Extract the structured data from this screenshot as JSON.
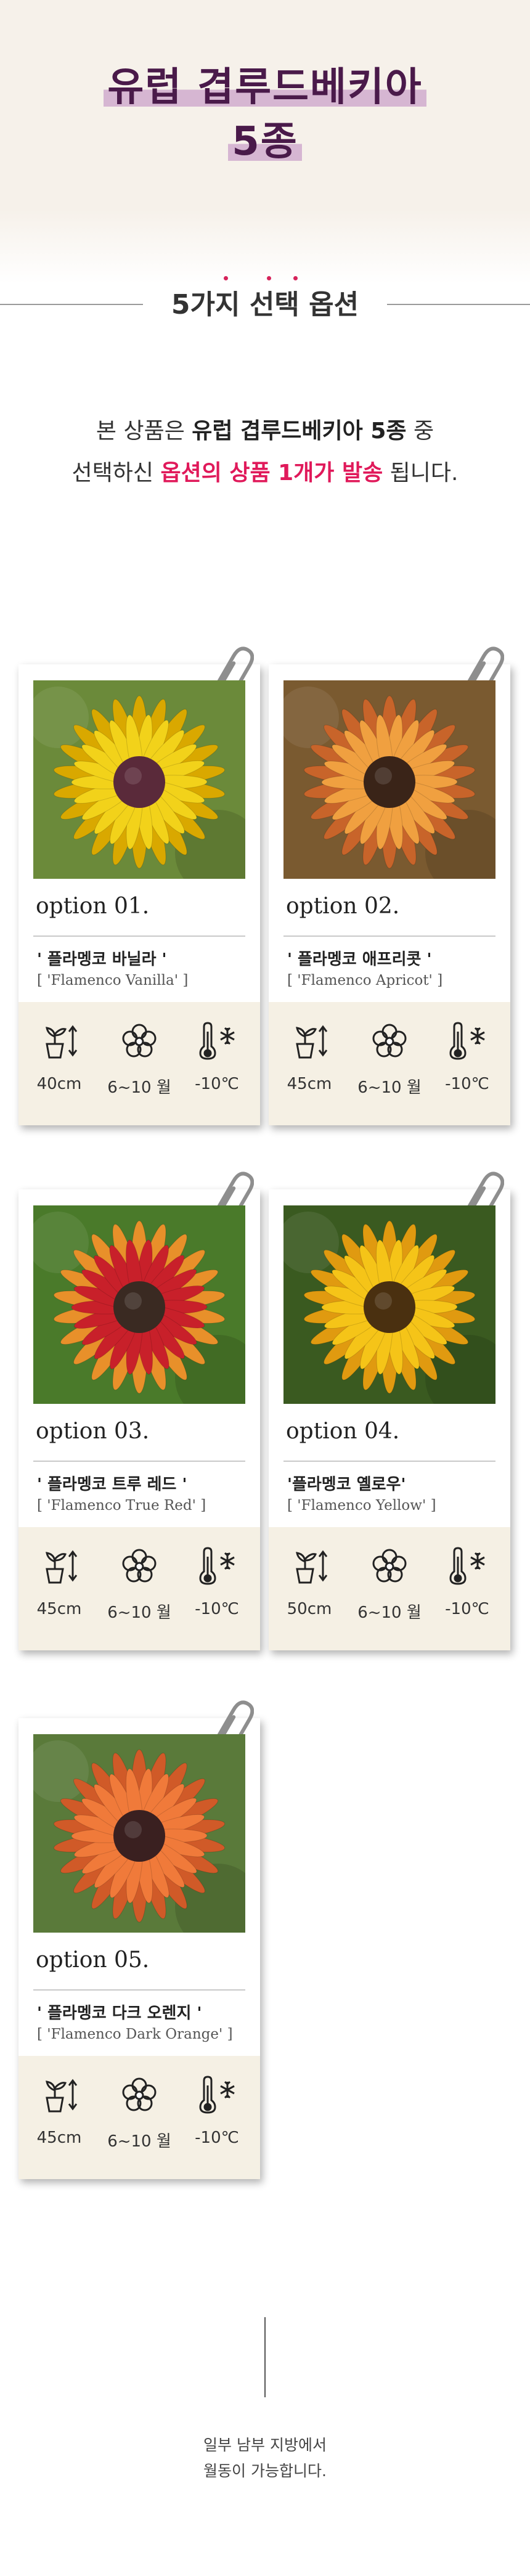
{
  "hero": {
    "title_line1": "유럽 겹루드베키아",
    "title_line2": "5종"
  },
  "section": {
    "title": "5가지 선택 옵션"
  },
  "description": {
    "line1_pre": "본 상품은 ",
    "line1_bold": "유럽 겹루드베키아 5종",
    "line1_post": " 중",
    "line2_pre": "선택하신 ",
    "line2_pink": "옵션의 상품 1개가 발송",
    "line2_post": " 됩니다."
  },
  "options": [
    {
      "label": "option 01.",
      "name_ko": "' 플라멩코 바닐라 '",
      "name_en": "[ 'Flamenco Vanilla' ]",
      "height": "40cm",
      "bloom": "6~10 월",
      "temp": "-10℃",
      "petal_color": "#f2d21a",
      "petal_edge": "#d9a800",
      "center": "#5a2a3a",
      "bg": "#6b8a3a"
    },
    {
      "label": "option 02.",
      "name_ko": "' 플라멩코 애프리콧 '",
      "name_en": "[ 'Flamenco Apricot' ]",
      "height": "45cm",
      "bloom": "6~10 월",
      "temp": "-10℃",
      "petal_color": "#f0a040",
      "petal_edge": "#c8642a",
      "center": "#3a2418",
      "bg": "#7a5a30"
    },
    {
      "label": "option 03.",
      "name_ko": "' 플라멩코 트루 레드 '",
      "name_en": "[ 'Flamenco True Red' ]",
      "height": "45cm",
      "bloom": "6~10 월",
      "temp": "-10℃",
      "petal_color": "#c8202a",
      "petal_edge": "#e8902a",
      "center": "#3a2a22",
      "bg": "#4a7a2a"
    },
    {
      "label": "option 04.",
      "name_ko": "'플라멩코 옐로우'",
      "name_en": "[ 'Flamenco Yellow' ]",
      "height": "50cm",
      "bloom": "6~10 월",
      "temp": "-10℃",
      "petal_color": "#f5c418",
      "petal_edge": "#e09a10",
      "center": "#4a3010",
      "bg": "#3a5a20"
    },
    {
      "label": "option 05.",
      "name_ko": "' 플라멩코 다크 오렌지 '",
      "name_en": "[ 'Flamenco Dark Orange' ]",
      "height": "45cm",
      "bloom": "6~10 월",
      "temp": "-10℃",
      "petal_color": "#f07a3a",
      "petal_edge": "#d05a28",
      "center": "#3a2020",
      "bg": "#5a7a3a"
    }
  ],
  "icons": {
    "height": "plant-height-icon",
    "bloom": "flower-icon",
    "temp": "thermometer-snow-icon",
    "clip": "paperclip-icon"
  },
  "footer": {
    "note_line1": "일부 남부 지방에서",
    "note_line2": "월동이 가능합니다."
  }
}
